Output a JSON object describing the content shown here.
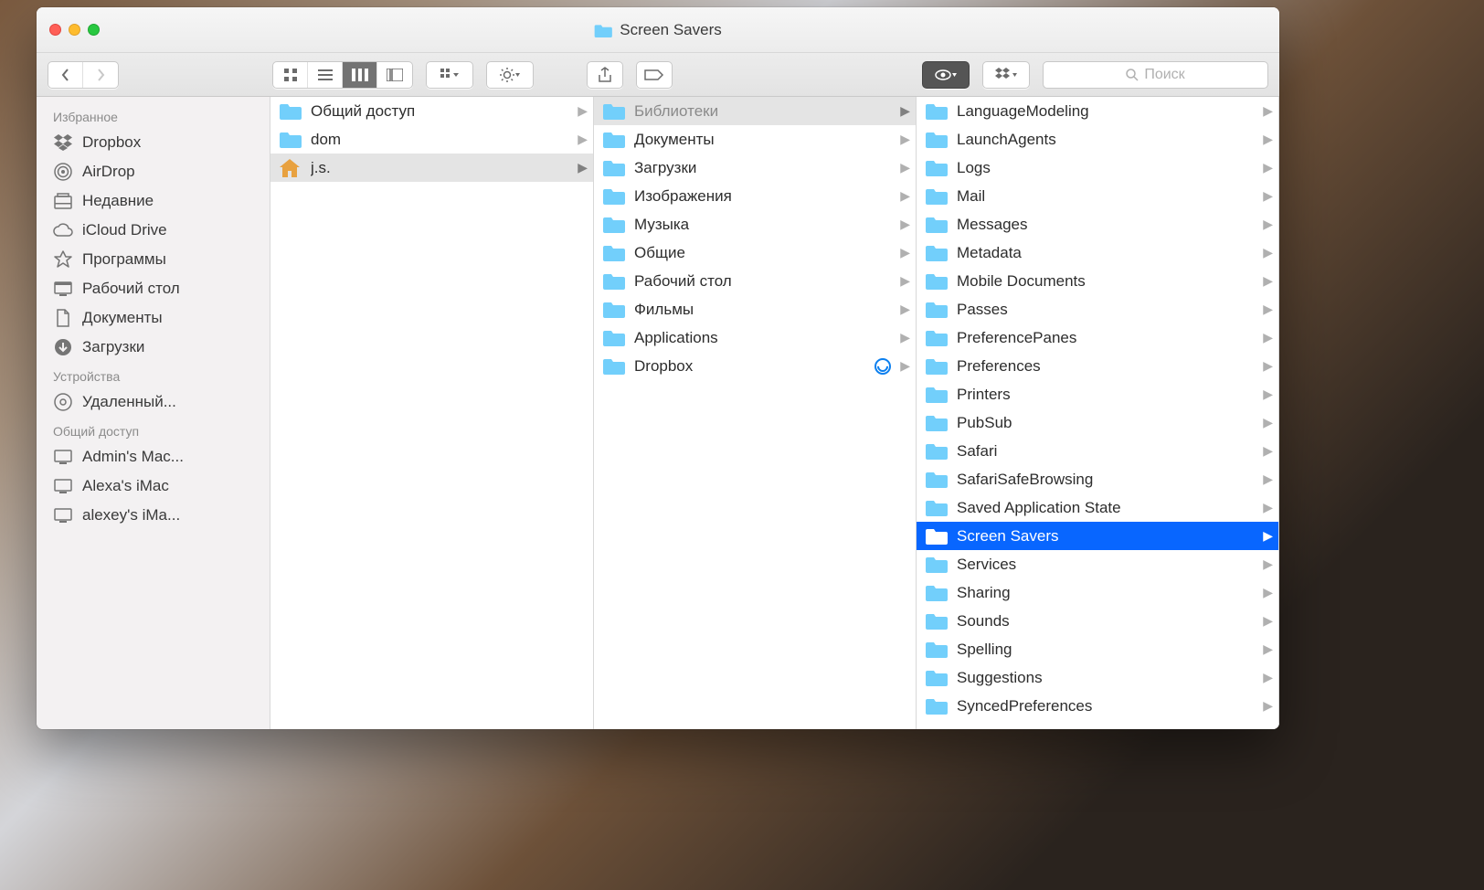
{
  "window_title": "Screen Savers",
  "search_placeholder": "Поиск",
  "sidebar": {
    "sections": [
      {
        "header": "Избранное",
        "items": [
          {
            "icon": "dropbox",
            "label": "Dropbox"
          },
          {
            "icon": "airdrop",
            "label": "AirDrop"
          },
          {
            "icon": "recents",
            "label": "Недавние"
          },
          {
            "icon": "icloud",
            "label": "iCloud Drive"
          },
          {
            "icon": "apps",
            "label": "Программы"
          },
          {
            "icon": "desktop",
            "label": "Рабочий стол"
          },
          {
            "icon": "docs",
            "label": "Документы"
          },
          {
            "icon": "downloads",
            "label": "Загрузки"
          }
        ]
      },
      {
        "header": "Устройства",
        "items": [
          {
            "icon": "disc",
            "label": "Удаленный..."
          }
        ]
      },
      {
        "header": "Общий доступ",
        "items": [
          {
            "icon": "computer",
            "label": "Admin's Mac..."
          },
          {
            "icon": "computer",
            "label": "Alexa's iMac"
          },
          {
            "icon": "computer",
            "label": "alexey's iMa..."
          }
        ]
      }
    ]
  },
  "col1": [
    {
      "icon": "folder",
      "label": "Общий доступ",
      "role": "none"
    },
    {
      "icon": "folder",
      "label": "dom",
      "role": "none"
    },
    {
      "icon": "home",
      "label": "j.s.",
      "role": "path"
    }
  ],
  "col2": [
    {
      "icon": "folder",
      "label": "Библиотеки",
      "role": "path_dim"
    },
    {
      "icon": "folder",
      "label": "Документы",
      "role": "none"
    },
    {
      "icon": "folder",
      "label": "Загрузки",
      "role": "none"
    },
    {
      "icon": "folder",
      "label": "Изображения",
      "role": "none"
    },
    {
      "icon": "folder",
      "label": "Музыка",
      "role": "none"
    },
    {
      "icon": "folder",
      "label": "Общие",
      "role": "none"
    },
    {
      "icon": "folder",
      "label": "Рабочий стол",
      "role": "none"
    },
    {
      "icon": "folder",
      "label": "Фильмы",
      "role": "none"
    },
    {
      "icon": "folder",
      "label": "Applications",
      "role": "none"
    },
    {
      "icon": "dropbox-folder",
      "label": "Dropbox",
      "role": "none",
      "sync": true
    }
  ],
  "col3": [
    {
      "label": "LanguageModeling",
      "role": "none"
    },
    {
      "label": "LaunchAgents",
      "role": "none"
    },
    {
      "label": "Logs",
      "role": "none"
    },
    {
      "label": "Mail",
      "role": "none"
    },
    {
      "label": "Messages",
      "role": "none"
    },
    {
      "label": "Metadata",
      "role": "none"
    },
    {
      "label": "Mobile Documents",
      "role": "none"
    },
    {
      "label": "Passes",
      "role": "none"
    },
    {
      "label": "PreferencePanes",
      "role": "none"
    },
    {
      "label": "Preferences",
      "role": "none"
    },
    {
      "label": "Printers",
      "role": "none"
    },
    {
      "label": "PubSub",
      "role": "none"
    },
    {
      "label": "Safari",
      "role": "none"
    },
    {
      "label": "SafariSafeBrowsing",
      "role": "none"
    },
    {
      "label": "Saved Application State",
      "role": "none"
    },
    {
      "label": "Screen Savers",
      "role": "active"
    },
    {
      "label": "Services",
      "role": "none"
    },
    {
      "label": "Sharing",
      "role": "none"
    },
    {
      "label": "Sounds",
      "role": "none"
    },
    {
      "label": "Spelling",
      "role": "none"
    },
    {
      "label": "Suggestions",
      "role": "none"
    },
    {
      "label": "SyncedPreferences",
      "role": "none"
    }
  ]
}
